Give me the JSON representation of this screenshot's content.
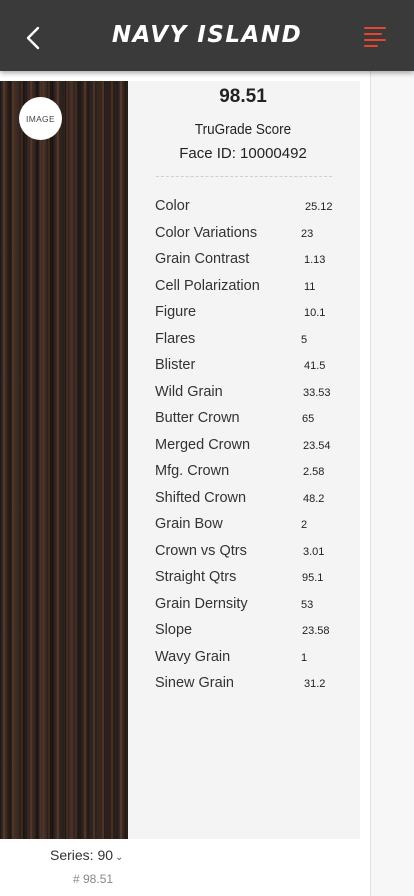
{
  "header": {
    "brand": "NAVY ISLAND",
    "back_icon": "chevron-left-icon",
    "menu_icon": "menu-icon",
    "accent_color": "#e8452e"
  },
  "panel": {
    "image_badge": "IMAGE",
    "score": "98.51",
    "score_label": "TruGrade Score",
    "face_id": "Face ID: 10000492",
    "metrics": [
      {
        "name": "Color",
        "value": "25.12"
      },
      {
        "name": "Color Variations",
        "value": "23"
      },
      {
        "name": "Grain Contrast",
        "value": "1.13"
      },
      {
        "name": "Cell Polarization",
        "value": "11"
      },
      {
        "name": "Figure",
        "value": "10.1"
      },
      {
        "name": "Flares",
        "value": "5"
      },
      {
        "name": "Blister",
        "value": "41.5"
      },
      {
        "name": "Wild Grain",
        "value": "33.53"
      },
      {
        "name": "Butter Crown",
        "value": "65"
      },
      {
        "name": "Merged Crown",
        "value": "23.54"
      },
      {
        "name": "Mfg. Crown",
        "value": "2.58"
      },
      {
        "name": "Shifted Crown",
        "value": "48.2"
      },
      {
        "name": "Grain Bow",
        "value": "2"
      },
      {
        "name": "Crown vs Qtrs",
        "value": "3.01"
      },
      {
        "name": "Straight Qtrs",
        "value": "95.1"
      },
      {
        "name": "Grain Dernsity",
        "value": "53"
      },
      {
        "name": "Slope",
        "value": "23.58"
      },
      {
        "name": "Wavy Grain",
        "value": "1"
      },
      {
        "name": "Sinew Grain",
        "value": "31.2"
      }
    ]
  },
  "footer": {
    "series": "Series: 90",
    "series_sub": "# 98.51"
  }
}
